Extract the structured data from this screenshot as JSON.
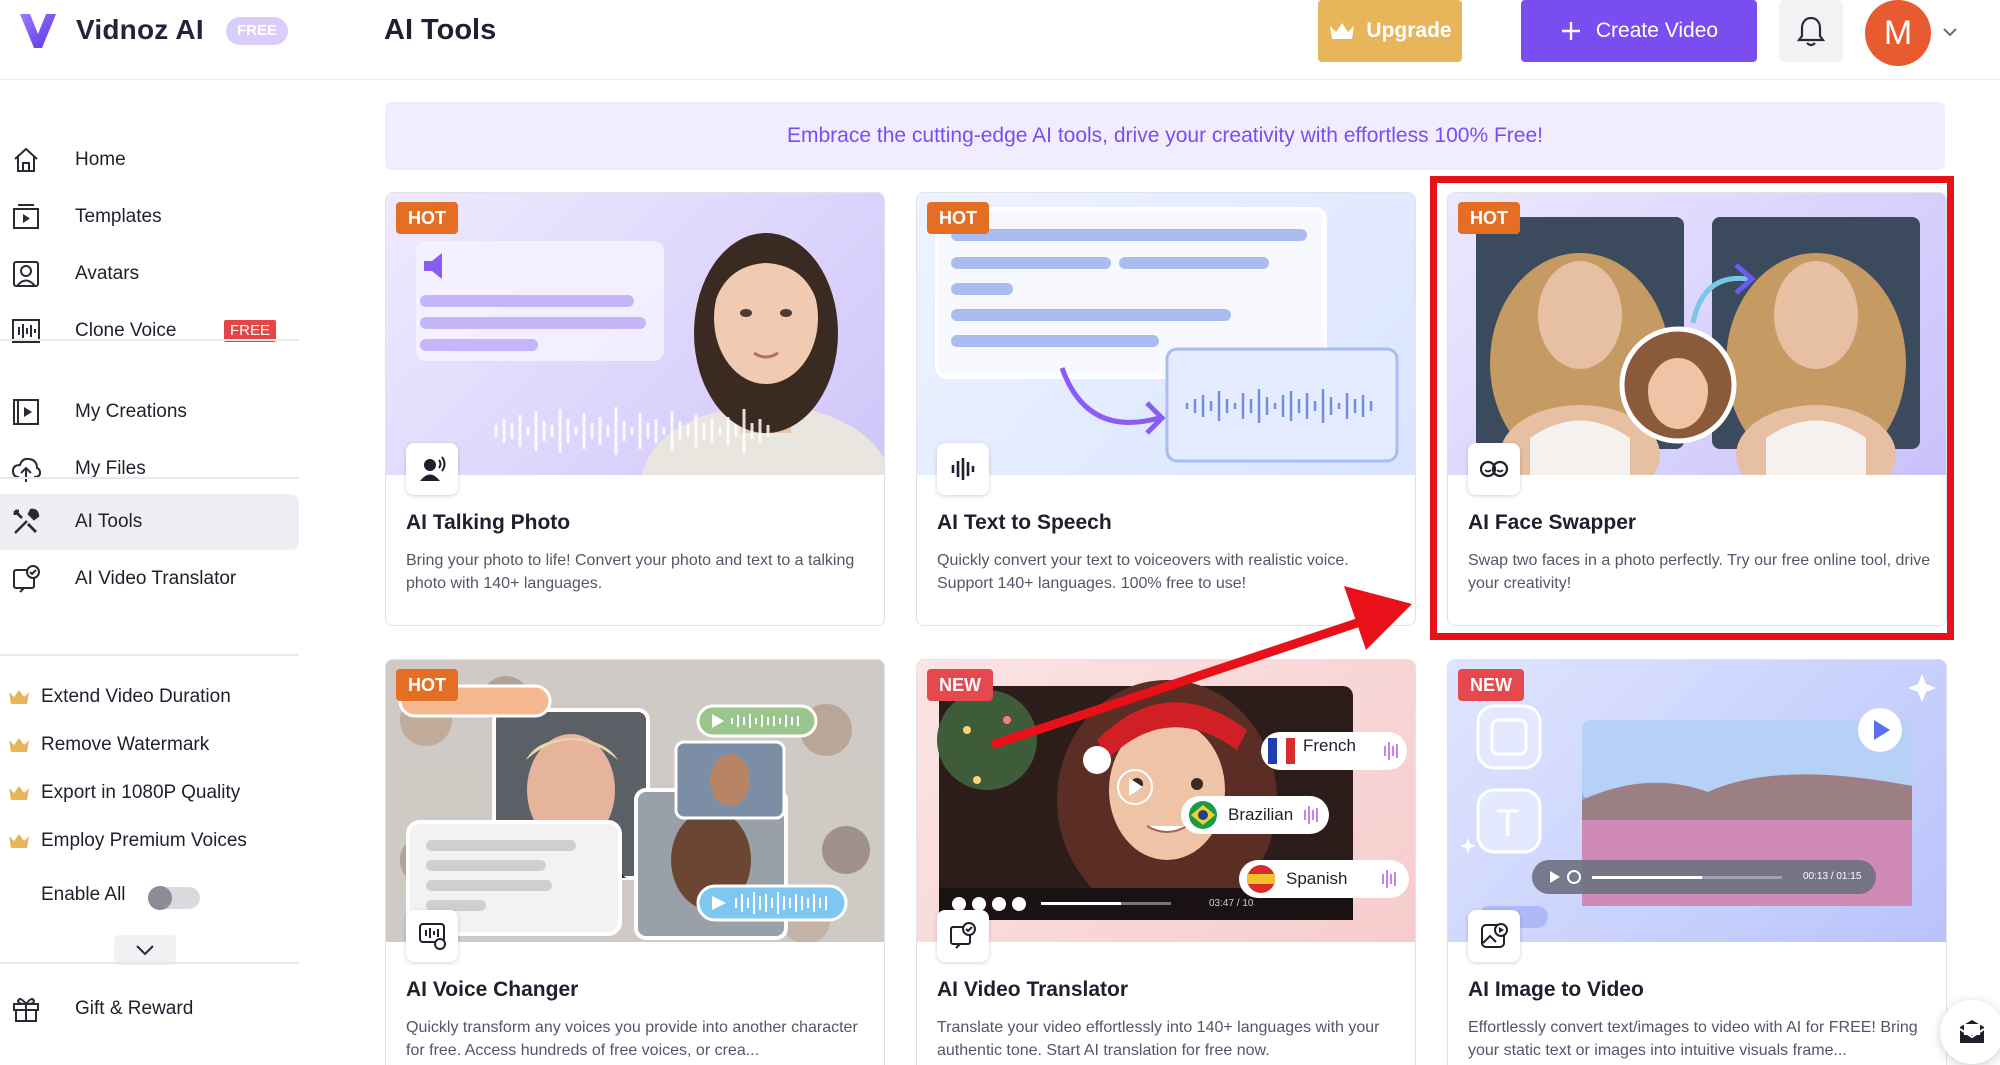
{
  "header": {
    "brand": "Vidnoz AI",
    "free_badge": "FREE",
    "page_title": "AI Tools",
    "upgrade_label": "Upgrade",
    "create_label": "Create Video",
    "avatar_initial": "M"
  },
  "sidebar": {
    "nav": [
      {
        "label": "Home",
        "icon": "home-icon"
      },
      {
        "label": "Templates",
        "icon": "templates-icon"
      },
      {
        "label": "Avatars",
        "icon": "avatar-icon"
      },
      {
        "label": "Clone Voice",
        "icon": "clone-voice-icon",
        "badge": "FREE"
      },
      {
        "label": "My Creations",
        "icon": "creations-icon"
      },
      {
        "label": "My Files",
        "icon": "upload-cloud-icon"
      },
      {
        "label": "AI Tools",
        "icon": "tools-icon",
        "active": true
      },
      {
        "label": "AI Video Translator",
        "icon": "translator-icon"
      }
    ],
    "premium": [
      "Extend Video Duration",
      "Remove Watermark",
      "Export in 1080P Quality",
      "Employ Premium Voices"
    ],
    "enable_all_label": "Enable All",
    "enable_all_on": false,
    "gift_label": "Gift & Reward"
  },
  "banner": "Embrace the cutting-edge AI tools, drive your creativity with effortless 100% Free!",
  "cards": [
    {
      "badge": "HOT",
      "title": "AI Talking Photo",
      "desc": "Bring your photo to life! Convert your photo and text to a talking photo with 140+ languages.",
      "icon": "talking-photo-icon"
    },
    {
      "badge": "HOT",
      "title": "AI Text to Speech",
      "desc": "Quickly convert your text to voiceovers with realistic voice. Support 140+ languages. 100% free to use!",
      "icon": "waveform-icon"
    },
    {
      "badge": "HOT",
      "title": "AI Face Swapper",
      "desc": "Swap two faces in a photo perfectly. Try our free online tool, drive your creativity!",
      "icon": "face-swap-icon"
    },
    {
      "badge": "HOT",
      "title": "AI Voice Changer",
      "desc": "Quickly transform any voices you provide into another character for free. Access hundreds of free voices, or crea...",
      "icon": "voice-changer-icon"
    },
    {
      "badge": "NEW",
      "title": "AI Video Translator",
      "desc": "Translate your video effortlessly into 140+ languages with your authentic tone. Start AI translation for free now.",
      "icon": "video-translator-icon",
      "languages": [
        "French",
        "Brazilian",
        "Spanish"
      ],
      "player_time": "03:47 / 10"
    },
    {
      "badge": "NEW",
      "title": "AI Image to Video",
      "desc": "Effortlessly convert text/images to video with AI for FREE! Bring your static text or images into intuitive visuals frame...",
      "icon": "image-to-video-icon",
      "player_time": "00:13 / 01:15"
    }
  ],
  "colors": {
    "accent": "#7a4df0",
    "upgrade": "#e8b65a",
    "hot_badge": "#e46f24",
    "new_badge": "#e5484d",
    "free_badge": "#e54545",
    "highlight": "#e8111a"
  }
}
